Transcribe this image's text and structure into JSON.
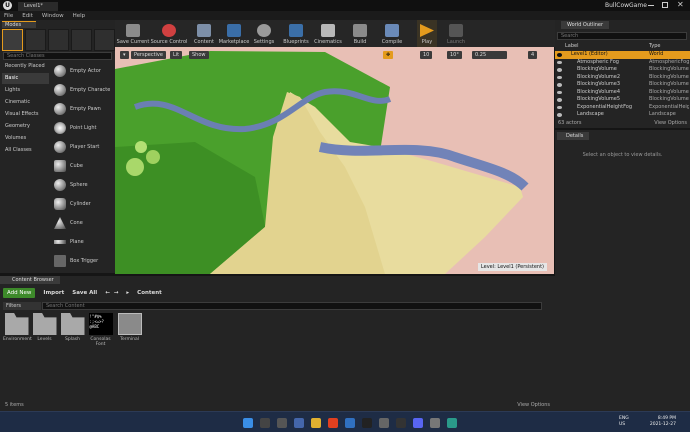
{
  "window": {
    "tab_title": "Level1*",
    "project_name": "BullCowGame"
  },
  "menu": [
    "File",
    "Edit",
    "Window",
    "Help"
  ],
  "modes": {
    "tab_label": "Modes",
    "search_placeholder": "Search Classes",
    "categories": [
      "Recently Placed",
      "Basic",
      "Lights",
      "Cinematic",
      "Visual Effects",
      "Geometry",
      "Volumes",
      "All Classes"
    ],
    "active_category": "Basic",
    "actors": [
      "Empty Actor",
      "Empty Character",
      "Empty Pawn",
      "Point Light",
      "Player Start",
      "Cube",
      "Sphere",
      "Cylinder",
      "Cone",
      "Plane",
      "Box Trigger"
    ]
  },
  "toolbar": {
    "buttons": [
      "Save Current",
      "Source Control",
      "Content",
      "Marketplace",
      "Settings",
      "Blueprints",
      "Cinematics",
      "Build",
      "Compile",
      "Play",
      "Launch"
    ]
  },
  "viewport": {
    "perspective_label": "Perspective",
    "lit_label": "Lit",
    "show_label": "Show",
    "grid_value": "10",
    "rotation_value": "10°",
    "scale_value": "0.25",
    "camera_speed": "4",
    "level_label": "Level:  Level1 (Persistent)"
  },
  "content_browser": {
    "tab_label": "Content Browser",
    "add_new_label": "Add New",
    "import_label": "Import",
    "save_all_label": "Save All",
    "path_label": "Content",
    "filters_label": "Filters",
    "search_placeholder": "Search Content",
    "assets": [
      "Environment",
      "Levels",
      "Splash",
      "Consolas Font",
      "Terminal"
    ],
    "status": "5 items",
    "view_options": "View Options"
  },
  "outliner": {
    "tab_label": "World Outliner",
    "search_placeholder": "Search",
    "col_label": "Label",
    "col_type": "Type",
    "rows": [
      {
        "name": "Level1 (Editor)",
        "type": "World"
      },
      {
        "name": "Atmospheric Fog",
        "type": "AtmosphericFog"
      },
      {
        "name": "BlockingVolume",
        "type": "BlockingVolume"
      },
      {
        "name": "BlockingVolume2",
        "type": "BlockingVolume"
      },
      {
        "name": "BlockingVolume3",
        "type": "BlockingVolume"
      },
      {
        "name": "BlockingVolume4",
        "type": "BlockingVolume"
      },
      {
        "name": "BlockingVolume5",
        "type": "BlockingVolume"
      },
      {
        "name": "ExponentialHeightFog",
        "type": "ExponentialHeightFog"
      },
      {
        "name": "Landscape",
        "type": "Landscape"
      }
    ],
    "actor_count": "63 actors",
    "view_options": "View Options"
  },
  "details": {
    "tab_label": "Details",
    "hint": "Select an object to view details."
  },
  "taskbar": {
    "lang": "ENG",
    "region": "US",
    "time": "8:49 PM",
    "date": "2021-12-27"
  },
  "colors": {
    "accent": "#e49b1d",
    "grass": "#4aa02c",
    "sand": "#e8dc9e",
    "selection": "#e49b1d"
  }
}
